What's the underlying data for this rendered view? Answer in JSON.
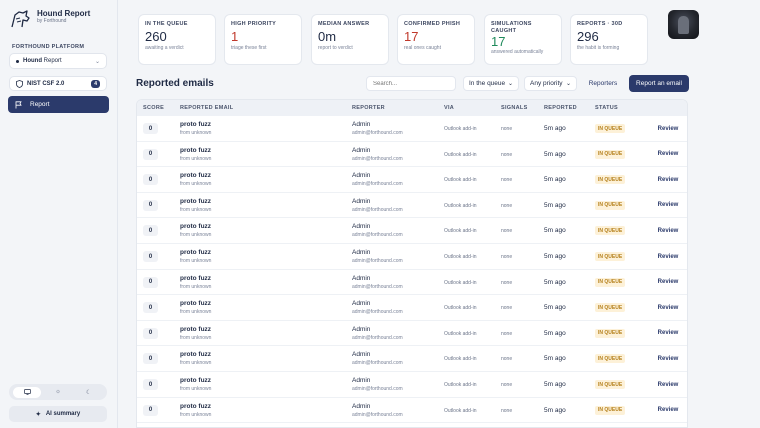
{
  "app": {
    "title": "Hound Report",
    "subtitle": "by Forthound",
    "logo_icon": "hound-logo-icon"
  },
  "sidebar": {
    "platform_label": "FORTHOUND PLATFORM",
    "platform_select_bold": "Hound",
    "platform_select_rest": " Report",
    "nist_label": "NIST CSF 2.0",
    "nist_badge": "4",
    "nav_report": "Report",
    "ai_summary": "AI summary",
    "theme_options": [
      "monitor-icon",
      "sun-icon",
      "moon-icon"
    ]
  },
  "stats": [
    {
      "label": "IN THE QUEUE",
      "value": "260",
      "sub": "awaiting a verdict",
      "tone": "default"
    },
    {
      "label": "HIGH PRIORITY",
      "value": "1",
      "sub": "triage these first",
      "tone": "red"
    },
    {
      "label": "MEDIAN ANSWER",
      "value": "0m",
      "sub": "report to verdict",
      "tone": "default"
    },
    {
      "label": "CONFIRMED PHISH",
      "value": "17",
      "sub": "real ones caught",
      "tone": "red"
    },
    {
      "label": "SIMULATIONS CAUGHT",
      "value": "17",
      "sub": "answered automatically",
      "tone": "green"
    },
    {
      "label": "REPORTS · 30D",
      "value": "296",
      "sub": "the habit is forming",
      "tone": "default"
    }
  ],
  "toolbar": {
    "section_title": "Reported emails",
    "search_placeholder": "Search...",
    "queue_filter": "In the queue",
    "priority_filter": "Any priority",
    "reporters_button": "Reporters",
    "report_button": "Report an email"
  },
  "table": {
    "headers": [
      "SCORE",
      "REPORTED EMAIL",
      "REPORTER",
      "VIA",
      "SIGNALS",
      "REPORTED",
      "STATUS"
    ],
    "rows": [
      {
        "score": "0",
        "subject": "proto fuzz",
        "from": "from unknown",
        "reporter": "Admin",
        "reporter_email": "admin@forthound.com",
        "via": "Outlook add-in",
        "signals": "none",
        "reported": "5m ago",
        "status": "IN QUEUE",
        "action": "Review"
      },
      {
        "score": "0",
        "subject": "proto fuzz",
        "from": "from unknown",
        "reporter": "Admin",
        "reporter_email": "admin@forthound.com",
        "via": "Outlook add-in",
        "signals": "none",
        "reported": "5m ago",
        "status": "IN QUEUE",
        "action": "Review"
      },
      {
        "score": "0",
        "subject": "proto fuzz",
        "from": "from unknown",
        "reporter": "Admin",
        "reporter_email": "admin@forthound.com",
        "via": "Outlook add-in",
        "signals": "none",
        "reported": "5m ago",
        "status": "IN QUEUE",
        "action": "Review"
      },
      {
        "score": "0",
        "subject": "proto fuzz",
        "from": "from unknown",
        "reporter": "Admin",
        "reporter_email": "admin@forthound.com",
        "via": "Outlook add-in",
        "signals": "none",
        "reported": "5m ago",
        "status": "IN QUEUE",
        "action": "Review"
      },
      {
        "score": "0",
        "subject": "proto fuzz",
        "from": "from unknown",
        "reporter": "Admin",
        "reporter_email": "admin@forthound.com",
        "via": "Outlook add-in",
        "signals": "none",
        "reported": "5m ago",
        "status": "IN QUEUE",
        "action": "Review"
      },
      {
        "score": "0",
        "subject": "proto fuzz",
        "from": "from unknown",
        "reporter": "Admin",
        "reporter_email": "admin@forthound.com",
        "via": "Outlook add-in",
        "signals": "none",
        "reported": "5m ago",
        "status": "IN QUEUE",
        "action": "Review"
      },
      {
        "score": "0",
        "subject": "proto fuzz",
        "from": "from unknown",
        "reporter": "Admin",
        "reporter_email": "admin@forthound.com",
        "via": "Outlook add-in",
        "signals": "none",
        "reported": "5m ago",
        "status": "IN QUEUE",
        "action": "Review"
      },
      {
        "score": "0",
        "subject": "proto fuzz",
        "from": "from unknown",
        "reporter": "Admin",
        "reporter_email": "admin@forthound.com",
        "via": "Outlook add-in",
        "signals": "none",
        "reported": "5m ago",
        "status": "IN QUEUE",
        "action": "Review"
      },
      {
        "score": "0",
        "subject": "proto fuzz",
        "from": "from unknown",
        "reporter": "Admin",
        "reporter_email": "admin@forthound.com",
        "via": "Outlook add-in",
        "signals": "none",
        "reported": "5m ago",
        "status": "IN QUEUE",
        "action": "Review"
      },
      {
        "score": "0",
        "subject": "proto fuzz",
        "from": "from unknown",
        "reporter": "Admin",
        "reporter_email": "admin@forthound.com",
        "via": "Outlook add-in",
        "signals": "none",
        "reported": "5m ago",
        "status": "IN QUEUE",
        "action": "Review"
      },
      {
        "score": "0",
        "subject": "proto fuzz",
        "from": "from unknown",
        "reporter": "Admin",
        "reporter_email": "admin@forthound.com",
        "via": "Outlook add-in",
        "signals": "none",
        "reported": "5m ago",
        "status": "IN QUEUE",
        "action": "Review"
      },
      {
        "score": "0",
        "subject": "proto fuzz",
        "from": "from unknown",
        "reporter": "Admin",
        "reporter_email": "admin@forthound.com",
        "via": "Outlook add-in",
        "signals": "none",
        "reported": "5m ago",
        "status": "IN QUEUE",
        "action": "Review"
      }
    ]
  },
  "colors": {
    "primary": "#2b3a6b",
    "danger": "#c0392b",
    "success": "#1f8a5b",
    "status_bg": "#fdf1d8",
    "status_text": "#b5801c"
  }
}
